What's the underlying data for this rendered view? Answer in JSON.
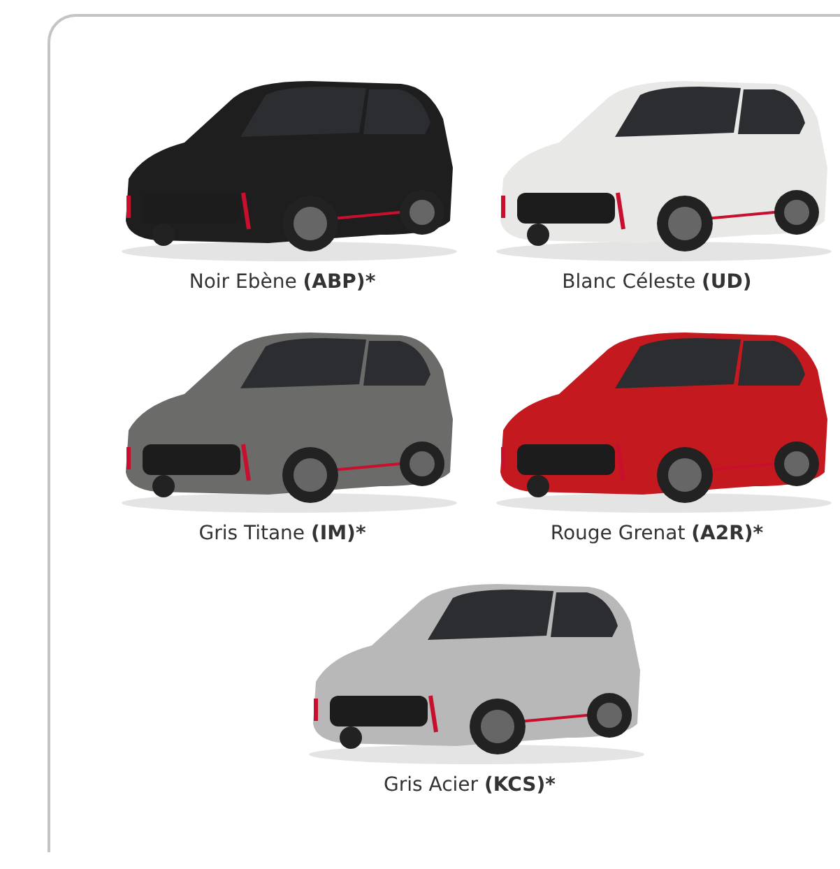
{
  "colors": [
    {
      "name": "Noir Ebène",
      "code": "(ABP)*",
      "color": "#1e1e1f"
    },
    {
      "name": "Blanc Céleste",
      "code": "(UD)",
      "color": "#e8e8e6"
    },
    {
      "name": "Gris Titane",
      "code": "(IM)*",
      "color": "#6b6b6a"
    },
    {
      "name": "Rouge Grenat",
      "code": "(A2R)*",
      "color": "#c41a1f"
    },
    {
      "name": "Gris Acier",
      "code": "(KCS)*",
      "color": "#b8b8b8"
    }
  ]
}
